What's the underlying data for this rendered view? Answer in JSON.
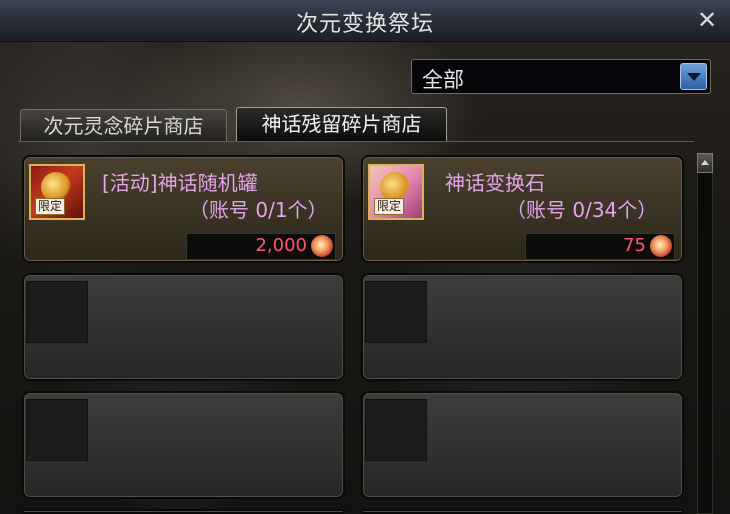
{
  "window": {
    "title": "次元变换祭坛",
    "close_icon": "close-icon"
  },
  "filter": {
    "selected": "全部"
  },
  "tabs": [
    {
      "label": "次元灵念碎片商店",
      "active": false
    },
    {
      "label": "神话残留碎片商店",
      "active": true
    }
  ],
  "items": [
    {
      "name": "[活动]神话随机罐",
      "limit": "（账号 0/1个）",
      "price": "2,000",
      "badge": "限定",
      "currency_icon": "coin-icon"
    },
    {
      "name": "神话变换石",
      "limit": "（账号 0/34个）",
      "price": "75",
      "badge": "限定",
      "currency_icon": "coin-icon"
    }
  ],
  "colors": {
    "item_text": "#e2a4ea",
    "price_text": "#ff5573",
    "frame_gold": "#d9b25b",
    "accent_blue": "#2c5ea8"
  }
}
